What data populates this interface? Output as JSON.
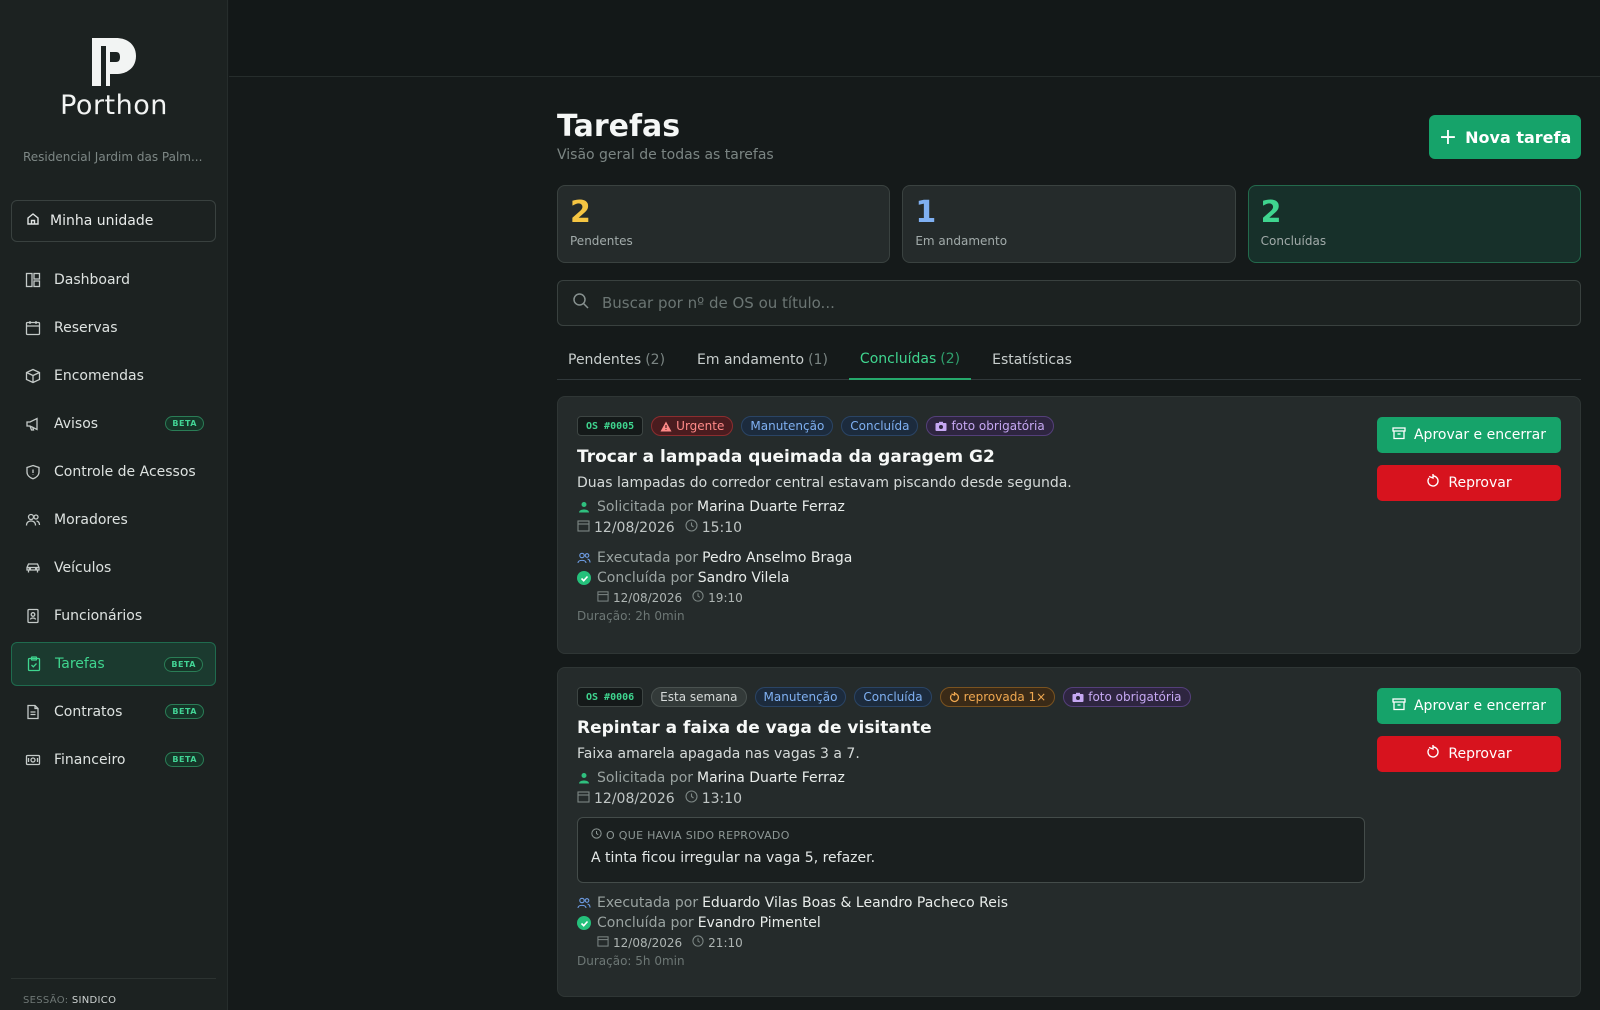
{
  "app": {
    "name": "Porthon",
    "condo": "Residencial Jardim das Palm..."
  },
  "sidebar": {
    "unit_label": "Minha unidade",
    "items": [
      {
        "label": "Dashboard",
        "icon": "dashboard-icon",
        "beta": ""
      },
      {
        "label": "Reservas",
        "icon": "calendar-icon",
        "beta": ""
      },
      {
        "label": "Encomendas",
        "icon": "package-icon",
        "beta": ""
      },
      {
        "label": "Avisos",
        "icon": "megaphone-icon",
        "beta": "BETA"
      },
      {
        "label": "Controle de Acessos",
        "icon": "shield-icon",
        "beta": ""
      },
      {
        "label": "Moradores",
        "icon": "users-icon",
        "beta": ""
      },
      {
        "label": "Veículos",
        "icon": "car-icon",
        "beta": ""
      },
      {
        "label": "Funcionários",
        "icon": "badge-icon",
        "beta": ""
      },
      {
        "label": "Tarefas",
        "icon": "clipboard-icon",
        "beta": "BETA"
      },
      {
        "label": "Contratos",
        "icon": "document-icon",
        "beta": "BETA"
      },
      {
        "label": "Financeiro",
        "icon": "money-icon",
        "beta": "BETA"
      }
    ],
    "session_label": "SESSÃO:",
    "session_user": "SINDICO"
  },
  "page": {
    "title": "Tarefas",
    "subtitle": "Visão geral de todas as tarefas",
    "new_button": "Nova tarefa",
    "stats": [
      {
        "value": "2",
        "label": "Pendentes",
        "color": "#f5c542"
      },
      {
        "value": "1",
        "label": "Em andamento",
        "color": "#7fb0f2"
      },
      {
        "value": "2",
        "label": "Concluídas",
        "color": "#3fd58f"
      }
    ],
    "search_placeholder": "Buscar por nº de OS ou título...",
    "tabs": [
      {
        "label": "Pendentes",
        "count": "(2)"
      },
      {
        "label": "Em andamento",
        "count": "(1)"
      },
      {
        "label": "Concluídas",
        "count": "(2)"
      },
      {
        "label": "Estatísticas",
        "count": ""
      }
    ]
  },
  "cards": [
    {
      "os": "OS #0005",
      "priority": "Urgente",
      "category": "Manutenção",
      "status": "Concluída",
      "photo": "foto obrigatória",
      "title": "Trocar a lampada queimada da garagem G2",
      "description": "Duas lampadas do corredor central estavam piscando desde segunda.",
      "requested_label": "Solicitada por",
      "requested_by": "Marina Duarte Ferraz",
      "date": "12/08/2026",
      "time": "15:10",
      "executed_label": "Executada por",
      "executed_by": "Pedro Anselmo Braga",
      "concluded_label": "Concluída por",
      "concluded_by": "Sandro Vilela",
      "concluded_date": "12/08/2026",
      "concluded_time": "19:10",
      "duration": "Duração: 2h 0min",
      "approve": "Aprovar e encerrar",
      "reject": "Reprovar"
    },
    {
      "os": "OS #0006",
      "priority": "Esta semana",
      "category": "Manutenção",
      "status": "Concluída",
      "rejected_badge": "reprovada 1×",
      "photo": "foto obrigatória",
      "title": "Repintar a faixa de vaga de visitante",
      "description": "Faixa amarela apagada nas vagas 3 a 7.",
      "requested_label": "Solicitada por",
      "requested_by": "Marina Duarte Ferraz",
      "date": "12/08/2026",
      "time": "13:10",
      "rejected_head": "O QUE HAVIA SIDO REPROVADO",
      "rejected_text": "A tinta ficou irregular na vaga 5, refazer.",
      "executed_label": "Executada por",
      "executed_by": "Eduardo Vilas Boas & Leandro Pacheco Reis",
      "concluded_label": "Concluída por",
      "concluded_by": "Evandro Pimentel",
      "concluded_date": "12/08/2026",
      "concluded_time": "21:10",
      "duration": "Duração: 5h 0min",
      "approve": "Aprovar e encerrar",
      "reject": "Reprovar"
    }
  ]
}
